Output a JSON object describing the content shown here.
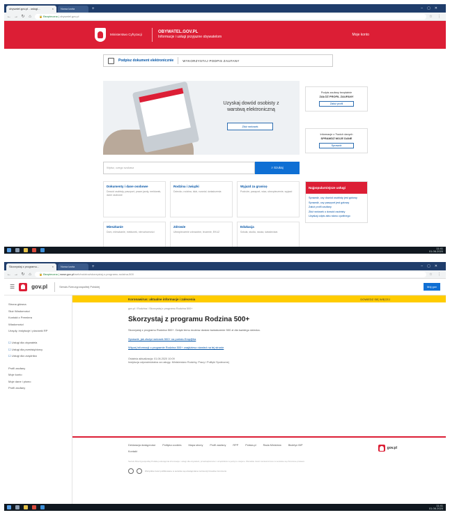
{
  "browser1": {
    "tab_title": "obywatel.gov.pl - usługi...",
    "tab2": "Nowa karta",
    "url_secure": "Bezpieczna |",
    "url": "obywatel.gov.pl"
  },
  "obywatel": {
    "ministry": "Ministerstwo Cyfryzacji",
    "portal_name": "OBYWATEL.GOV.PL",
    "portal_tagline": "Informacje i usługi przyjazne obywatelom",
    "login": "Moje konto",
    "sign_link": "Podpisz dokument elektronicznie",
    "sign_cta": "WYKORZYSTAJ PODPIS ZAUFANY",
    "hero_title": "Uzyskaj dowód osobisty z warstwą elektroniczną",
    "hero_button": "Złóż wniosek",
    "side1_text": "Podpis zaufany bezpłatnie",
    "side1_bold": "ZAŁÓŻ PROFIL ZAUFANY",
    "side1_button": "Załóż profil",
    "side2_text": "Informacje o Twoich danych",
    "side2_bold": "SPRAWDŹ MOJE DANE",
    "side2_button": "Sprawdź",
    "search_placeholder": "Wpisz, czego szukasz",
    "search_button": "Szukaj",
    "tiles": [
      {
        "title": "Dokumenty i dane osobowe",
        "desc": "Dowód osobisty, paszport, prawo jazdy, meldunek, dane osobowe"
      },
      {
        "title": "Rodzina i związki",
        "desc": "Dziecko, rodzina, ślub, rozwód, świadczenia"
      },
      {
        "title": "Wyjazd za granicę",
        "desc": "Podróże, paszport, wiza, ubezpieczenie, wyjazd"
      },
      {
        "title": "Mieszkanie",
        "desc": "Dom, mieszkanie, meldunek, nieruchomości"
      },
      {
        "title": "Zdrowie",
        "desc": "Ubezpieczenie zdrowotne, leczenie, EKUZ"
      },
      {
        "title": "Edukacja",
        "desc": "Szkoła, studia, nauka, świadectwa"
      }
    ],
    "popular_title": "Najpopularniejsze usługi",
    "popular": [
      "Sprawdź, czy dowód osobisty jest gotowy",
      "Sprawdź, czy paszport jest gotowy",
      "Załóż profil zaufany",
      "Złóż wniosek o dowód osobisty",
      "Uzyskaj odpis aktu stanu cywilnego"
    ]
  },
  "browser2": {
    "tab_title": "Skorzystaj z programu...",
    "tab2": "Nowa karta",
    "url_secure": "Bezpieczna |",
    "url": "www.gov.pl",
    "url_rest": "/web/rodzina/skorzystaj-z-programu-rodzina-500"
  },
  "gov": {
    "brand": "gov.pl",
    "subtitle": "Serwis Rzeczypospolitej Polskiej",
    "login": "Mój gov",
    "sidebar_main": [
      "Strona główna",
      "Służ Wiadomości",
      "Kontakt z Premiera",
      "Wiadomości",
      "Urzędy, instytucje i placówki RP"
    ],
    "sidebar_checks": [
      "Usługi dla obywatela",
      "Usługi dla przedsiębiorcy",
      "Usługi dla urzędnika"
    ],
    "sidebar_bottom": [
      "Profil zaufany",
      "Moje konto",
      "Moje dane i pismo",
      "Profil zaufany"
    ],
    "alert": "Koronawirus: aktualne informacje i zalecenia",
    "alert_more": "DOWIEDZ SIĘ WIĘCEJ",
    "breadcrumb": "gov.pl  /  Rodzina  /  Skorzystaj z programu Rodzina 500+",
    "title": "Skorzystaj z programu Rodzina 500+",
    "intro": "Skorzystaj z programu Rodzina 500+. Dzięki temu możesz dostać świadczenie 500 zł dla każdego dziecka.",
    "link1": "Sprawdź, jak złożyć wniosek 500+ na portalu Emp@tia",
    "link2": "Więcej informacji o programie Rodzina 500+ znajdziesz również na tej stronie",
    "meta1": "Ostatnia aktualizacja: 01.06.2020 10:09",
    "meta2": "Instytucja odpowiedzialna za usługę: Ministerstwo Rodziny, Pracy i Polityki Społecznej",
    "footer_links": [
      "Deklaracja dostępności",
      "Polityka cookies",
      "Mapa strony",
      "Profil zaufany",
      "RPP",
      "Polska.pl",
      "Rada Ministrów",
      "Biuletyn BIP",
      "Kontakt"
    ],
    "footer_brand": "gov.pl",
    "fine_print": "Serwis Rzeczypospolitej Polskiej udostępnia informacje i usługi dla obywateli, przedsiębiorców i urzędników w jednym miejscu. Wszelkie treści zamieszczone w serwisie są chronione prawem.",
    "license": "Wszystkie treści publikowane w serwisie są udostępniane na licencji Creative Commons"
  },
  "taskbar": {
    "time": "11:41",
    "date": "01.06.2020"
  }
}
